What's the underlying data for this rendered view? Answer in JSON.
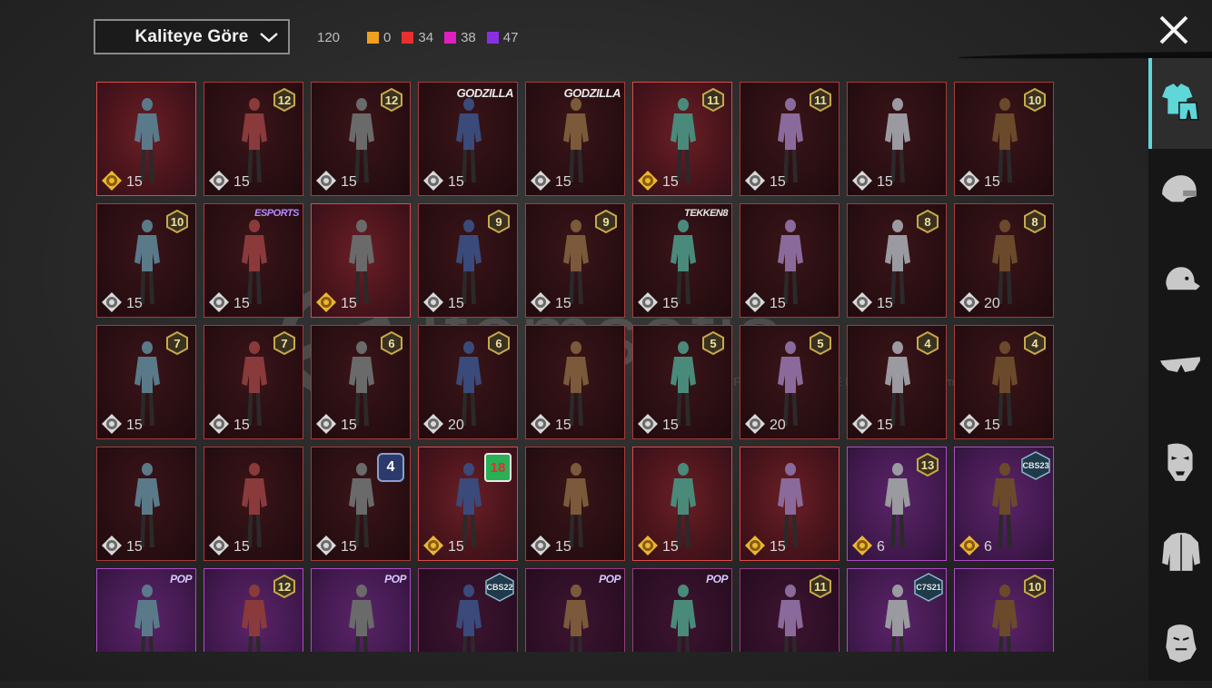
{
  "sort": {
    "label": "Kaliteye Göre"
  },
  "counts": {
    "total": "120",
    "tiers": [
      {
        "color": "#f0a020",
        "value": "0"
      },
      {
        "color": "#e83030",
        "value": "34"
      },
      {
        "color": "#e020c0",
        "value": "38"
      },
      {
        "color": "#8a30e0",
        "value": "47"
      }
    ]
  },
  "watermark": {
    "brand": "Itemsatis",
    "tagline": "HESAP / SKIN / ITEM / E-PIN",
    "domain": ".com"
  },
  "items": [
    {
      "count": "15",
      "coin": "gold",
      "style": "bright",
      "tag": null
    },
    {
      "count": "15",
      "coin": "silver",
      "style": "dark",
      "tag": {
        "type": "level",
        "text": "12"
      }
    },
    {
      "count": "15",
      "coin": "silver",
      "style": "dark",
      "tag": {
        "type": "level",
        "text": "12"
      }
    },
    {
      "count": "15",
      "coin": "silver",
      "style": "dark",
      "tag": {
        "type": "text",
        "text": "GODZILLA"
      }
    },
    {
      "count": "15",
      "coin": "silver",
      "style": "dark",
      "tag": {
        "type": "text",
        "text": "GODZILLA"
      }
    },
    {
      "count": "15",
      "coin": "gold",
      "style": "bright",
      "tag": {
        "type": "level",
        "text": "11"
      }
    },
    {
      "count": "15",
      "coin": "silver",
      "style": "dark",
      "tag": {
        "type": "level",
        "text": "11"
      }
    },
    {
      "count": "15",
      "coin": "silver",
      "style": "dark",
      "tag": null
    },
    {
      "count": "15",
      "coin": "silver",
      "style": "dark",
      "tag": {
        "type": "level",
        "text": "10"
      }
    },
    {
      "count": "15",
      "coin": "silver",
      "style": "dark",
      "tag": {
        "type": "level",
        "text": "10"
      }
    },
    {
      "count": "15",
      "coin": "silver",
      "style": "dark",
      "tag": {
        "type": "esports",
        "text": "ESPORTS"
      }
    },
    {
      "count": "15",
      "coin": "gold",
      "style": "bright",
      "tag": null
    },
    {
      "count": "15",
      "coin": "silver",
      "style": "dark",
      "tag": {
        "type": "level",
        "text": "9"
      }
    },
    {
      "count": "15",
      "coin": "silver",
      "style": "dark",
      "tag": {
        "type": "level",
        "text": "9"
      }
    },
    {
      "count": "15",
      "coin": "silver",
      "style": "dark",
      "tag": {
        "type": "tekken",
        "text": "TEKKEN8"
      }
    },
    {
      "count": "15",
      "coin": "silver",
      "style": "dark",
      "tag": null
    },
    {
      "count": "15",
      "coin": "silver",
      "style": "dark",
      "tag": {
        "type": "level",
        "text": "8"
      }
    },
    {
      "count": "20",
      "coin": "silver",
      "style": "dark",
      "tag": {
        "type": "level",
        "text": "8"
      }
    },
    {
      "count": "15",
      "coin": "silver",
      "style": "dark",
      "tag": {
        "type": "level",
        "text": "7"
      }
    },
    {
      "count": "15",
      "coin": "silver",
      "style": "dark",
      "tag": {
        "type": "level",
        "text": "7"
      }
    },
    {
      "count": "15",
      "coin": "silver",
      "style": "dark",
      "tag": {
        "type": "level",
        "text": "6"
      }
    },
    {
      "count": "20",
      "coin": "silver",
      "style": "dark",
      "tag": {
        "type": "level",
        "text": "6"
      }
    },
    {
      "count": "15",
      "coin": "silver",
      "style": "dark",
      "tag": null
    },
    {
      "count": "15",
      "coin": "silver",
      "style": "dark",
      "tag": {
        "type": "level",
        "text": "5"
      }
    },
    {
      "count": "20",
      "coin": "silver",
      "style": "dark",
      "tag": {
        "type": "level",
        "text": "5"
      }
    },
    {
      "count": "15",
      "coin": "silver",
      "style": "dark",
      "tag": {
        "type": "level",
        "text": "4"
      }
    },
    {
      "count": "15",
      "coin": "silver",
      "style": "dark",
      "tag": {
        "type": "level",
        "text": "4"
      }
    },
    {
      "count": "15",
      "coin": "silver",
      "style": "dark",
      "tag": null
    },
    {
      "count": "15",
      "coin": "silver",
      "style": "dark",
      "tag": null
    },
    {
      "count": "15",
      "coin": "silver",
      "style": "dark",
      "tag": {
        "type": "badge4",
        "text": "4"
      }
    },
    {
      "count": "15",
      "coin": "gold",
      "style": "bright",
      "tag": {
        "type": "badge18",
        "text": "18"
      }
    },
    {
      "count": "15",
      "coin": "silver",
      "style": "dark",
      "tag": null
    },
    {
      "count": "15",
      "coin": "gold",
      "style": "bright",
      "tag": null
    },
    {
      "count": "15",
      "coin": "gold",
      "style": "bright",
      "tag": null
    },
    {
      "count": "6",
      "coin": "gold",
      "style": "purple",
      "tag": {
        "type": "level",
        "text": "13"
      }
    },
    {
      "count": "6",
      "coin": "gold",
      "style": "purple",
      "tag": {
        "type": "cbs",
        "text": "CBS23"
      }
    },
    {
      "count": "",
      "coin": "none",
      "style": "purple",
      "tag": {
        "type": "pop",
        "text": "POP"
      }
    },
    {
      "count": "",
      "coin": "none",
      "style": "purple",
      "tag": {
        "type": "level",
        "text": "12"
      }
    },
    {
      "count": "",
      "coin": "none",
      "style": "purple",
      "tag": {
        "type": "pop",
        "text": "POP"
      }
    },
    {
      "count": "",
      "coin": "none",
      "style": "plum",
      "tag": {
        "type": "cbs",
        "text": "CBS22"
      }
    },
    {
      "count": "",
      "coin": "none",
      "style": "plum",
      "tag": {
        "type": "pop",
        "text": "POP"
      }
    },
    {
      "count": "",
      "coin": "none",
      "style": "plum",
      "tag": {
        "type": "pop",
        "text": "POP"
      }
    },
    {
      "count": "",
      "coin": "none",
      "style": "plum",
      "tag": {
        "type": "level",
        "text": "11"
      }
    },
    {
      "count": "",
      "coin": "none",
      "style": "purple",
      "tag": {
        "type": "cbs",
        "text": "C7S21"
      }
    },
    {
      "count": "",
      "coin": "none",
      "style": "purple",
      "tag": {
        "type": "level",
        "text": "10"
      }
    }
  ],
  "sidebar": {
    "tabs": [
      {
        "icon": "outfit-icon",
        "active": true
      },
      {
        "icon": "helmet-icon",
        "active": false
      },
      {
        "icon": "cap-icon",
        "active": false
      },
      {
        "icon": "glasses-icon",
        "active": false
      },
      {
        "icon": "mask-icon",
        "active": false
      },
      {
        "icon": "jacket-icon",
        "active": false
      },
      {
        "icon": "face-icon",
        "active": false
      }
    ]
  }
}
